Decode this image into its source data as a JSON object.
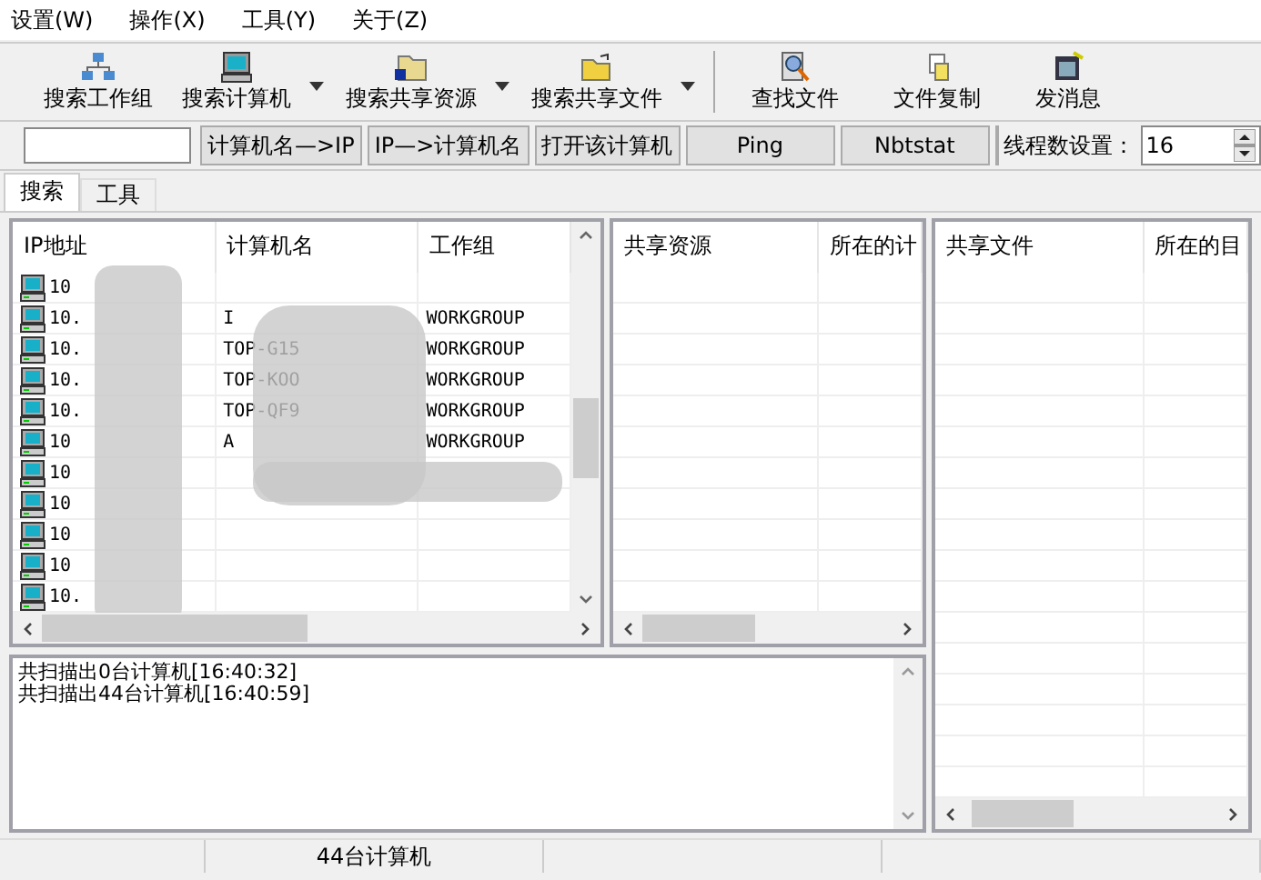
{
  "menu": [
    "设置(W)",
    "操作(X)",
    "工具(Y)",
    "关于(Z)"
  ],
  "toolbar": [
    {
      "label": "搜索工作组",
      "kind": "network",
      "dropdown": false
    },
    {
      "label": "搜索计算机",
      "kind": "computer",
      "dropdown": true
    },
    {
      "label": "搜索共享资源",
      "kind": "share",
      "dropdown": true
    },
    {
      "label": "搜索共享文件",
      "kind": "folder",
      "dropdown": true
    },
    {
      "label": "查找文件",
      "kind": "find",
      "dropdown": false
    },
    {
      "label": "文件复制",
      "kind": "copy",
      "dropdown": false
    },
    {
      "label": "发消息",
      "kind": "message",
      "dropdown": false
    }
  ],
  "address_bar": {
    "buttons": [
      "计算机名—>IP",
      "IP—>计算机名",
      "打开该计算机",
      "Ping",
      "Nbtstat"
    ],
    "thread_label": "线程数设置：",
    "thread_value": "16"
  },
  "tabs": [
    {
      "label": "搜索",
      "selected": true
    },
    {
      "label": "工具",
      "selected": false
    }
  ],
  "hosts_table": {
    "columns": [
      "IP地址",
      "计算机名",
      "工作组"
    ],
    "rows": [
      {
        "ip": "10",
        "name": "",
        "workgroup": ""
      },
      {
        "ip": "10.",
        "name": "I",
        "workgroup": "WORKGROUP"
      },
      {
        "ip": "10.",
        "name": "TOP-G15",
        "workgroup": "WORKGROUP"
      },
      {
        "ip": "10.",
        "name": "TOP-KOO",
        "workgroup": "WORKGROUP"
      },
      {
        "ip": "10.",
        "name": "TOP-QF9",
        "workgroup": "WORKGROUP"
      },
      {
        "ip": "10",
        "name": "A",
        "workgroup": "WORKGROUP"
      },
      {
        "ip": "10",
        "name": "",
        "workgroup": ""
      },
      {
        "ip": "10",
        "name": "",
        "workgroup": ""
      },
      {
        "ip": "10",
        "name": "",
        "workgroup": ""
      },
      {
        "ip": "10",
        "name": "",
        "workgroup": ""
      },
      {
        "ip": "10.",
        "name": "",
        "workgroup": ""
      }
    ]
  },
  "shares_table": {
    "columns": [
      "共享资源",
      "所在的计"
    ]
  },
  "files_table": {
    "columns": [
      "共享文件",
      "所在的目"
    ]
  },
  "log": [
    "共扫描出0台计算机[16:40:32]",
    "共扫描出44台计算机[16:40:59]"
  ],
  "status_bar": {
    "count": "44台计算机"
  }
}
